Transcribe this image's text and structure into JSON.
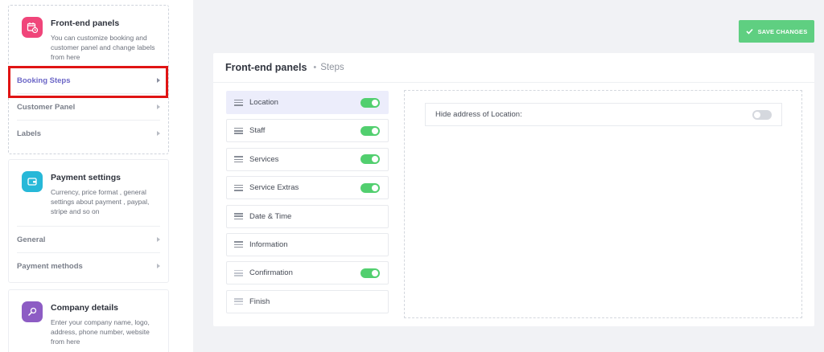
{
  "sidebar": {
    "frontend": {
      "title": "Front-end panels",
      "description": "You can customize booking and customer panel and change labels from here",
      "icon": "calendar-clock-icon",
      "color": "#f0457a",
      "items": [
        {
          "label": "Booking Steps"
        },
        {
          "label": "Customer Panel"
        },
        {
          "label": "Labels"
        }
      ]
    },
    "payment": {
      "title": "Payment settings",
      "description": "Currency, price format , general settings about payment , paypal, stripe and so on",
      "icon": "wallet-icon",
      "color": "#27b8d8",
      "items": [
        {
          "label": "General"
        },
        {
          "label": "Payment methods"
        }
      ]
    },
    "company": {
      "title": "Company details",
      "description": "Enter your company name, logo, address, phone number, website from here",
      "icon": "brush-icon",
      "color": "#8d5cc4"
    }
  },
  "toolbar": {
    "save_label": "SAVE CHANGES",
    "accent": "#5fcf81"
  },
  "panel": {
    "title": "Front-end panels",
    "separator": "•",
    "subtitle": "Steps"
  },
  "steps": [
    {
      "label": "Location",
      "enabled": true,
      "active": true
    },
    {
      "label": "Staff",
      "enabled": true
    },
    {
      "label": "Services",
      "enabled": true
    },
    {
      "label": "Service Extras",
      "enabled": true
    },
    {
      "label": "Date & Time",
      "enabled": null
    },
    {
      "label": "Information",
      "enabled": null
    },
    {
      "label": "Confirmation",
      "enabled": true
    },
    {
      "label": "Finish",
      "enabled": null
    }
  ],
  "settings": {
    "hide_address_label": "Hide address of Location:",
    "hide_address_value": false
  }
}
